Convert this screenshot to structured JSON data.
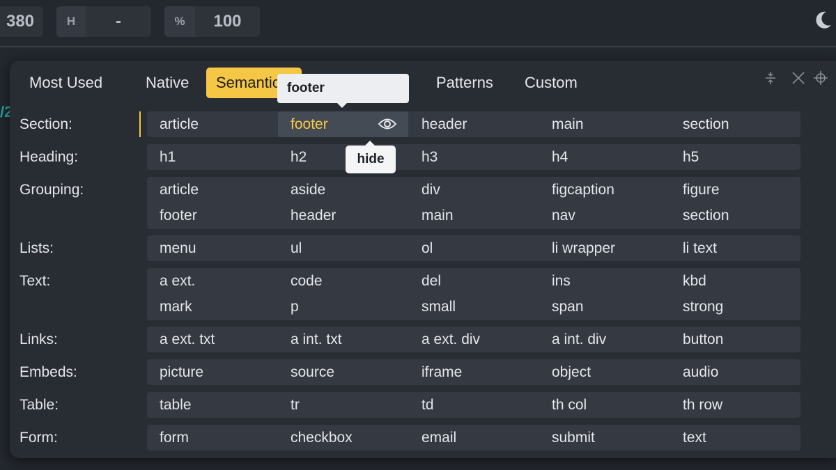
{
  "toolbar": {
    "width_value": "380",
    "height_prefix": "H",
    "height_value": "-",
    "percent_prefix": "%",
    "percent_value": "100",
    "theme_icon": "moon-icon"
  },
  "side_glyph": "/2",
  "tabs": [
    {
      "label": "Most Used",
      "active": false
    },
    {
      "label": "Native",
      "active": false
    },
    {
      "label": "Semantic",
      "active": true
    },
    {
      "label": "Patterns",
      "active": false
    },
    {
      "label": "Custom",
      "active": false
    }
  ],
  "tooltips": {
    "top": "footer",
    "hide": "hide"
  },
  "rows": [
    {
      "label": "Section:",
      "items": [
        "article",
        "footer",
        "header",
        "main",
        "section"
      ]
    },
    {
      "label": "Heading:",
      "items": [
        "h1",
        "h2",
        "h3",
        "h4",
        "h5"
      ]
    },
    {
      "label": "Grouping:",
      "items": [
        "article",
        "aside",
        "div",
        "figcaption",
        "figure",
        "footer",
        "header",
        "main",
        "nav",
        "section"
      ]
    },
    {
      "label": "Lists:",
      "items": [
        "menu",
        "ul",
        "ol",
        "li wrapper",
        "li text"
      ]
    },
    {
      "label": "Text:",
      "items": [
        "a ext.",
        "code",
        "del",
        "ins",
        "kbd",
        "mark",
        "p",
        "small",
        "span",
        "strong"
      ]
    },
    {
      "label": "Links:",
      "items": [
        "a ext. txt",
        "a int. txt",
        "a ext. div",
        "a int. div",
        "button"
      ]
    },
    {
      "label": "Embeds:",
      "items": [
        "picture",
        "source",
        "iframe",
        "object",
        "audio"
      ]
    },
    {
      "label": "Table:",
      "items": [
        "table",
        "tr",
        "td",
        "th col",
        "th row"
      ]
    },
    {
      "label": "Form:",
      "items": [
        "form",
        "checkbox",
        "email",
        "submit",
        "text"
      ]
    }
  ],
  "colors": {
    "accent": "#f6c744",
    "panel_bg": "#282c33",
    "row_bg": "#353a42"
  }
}
